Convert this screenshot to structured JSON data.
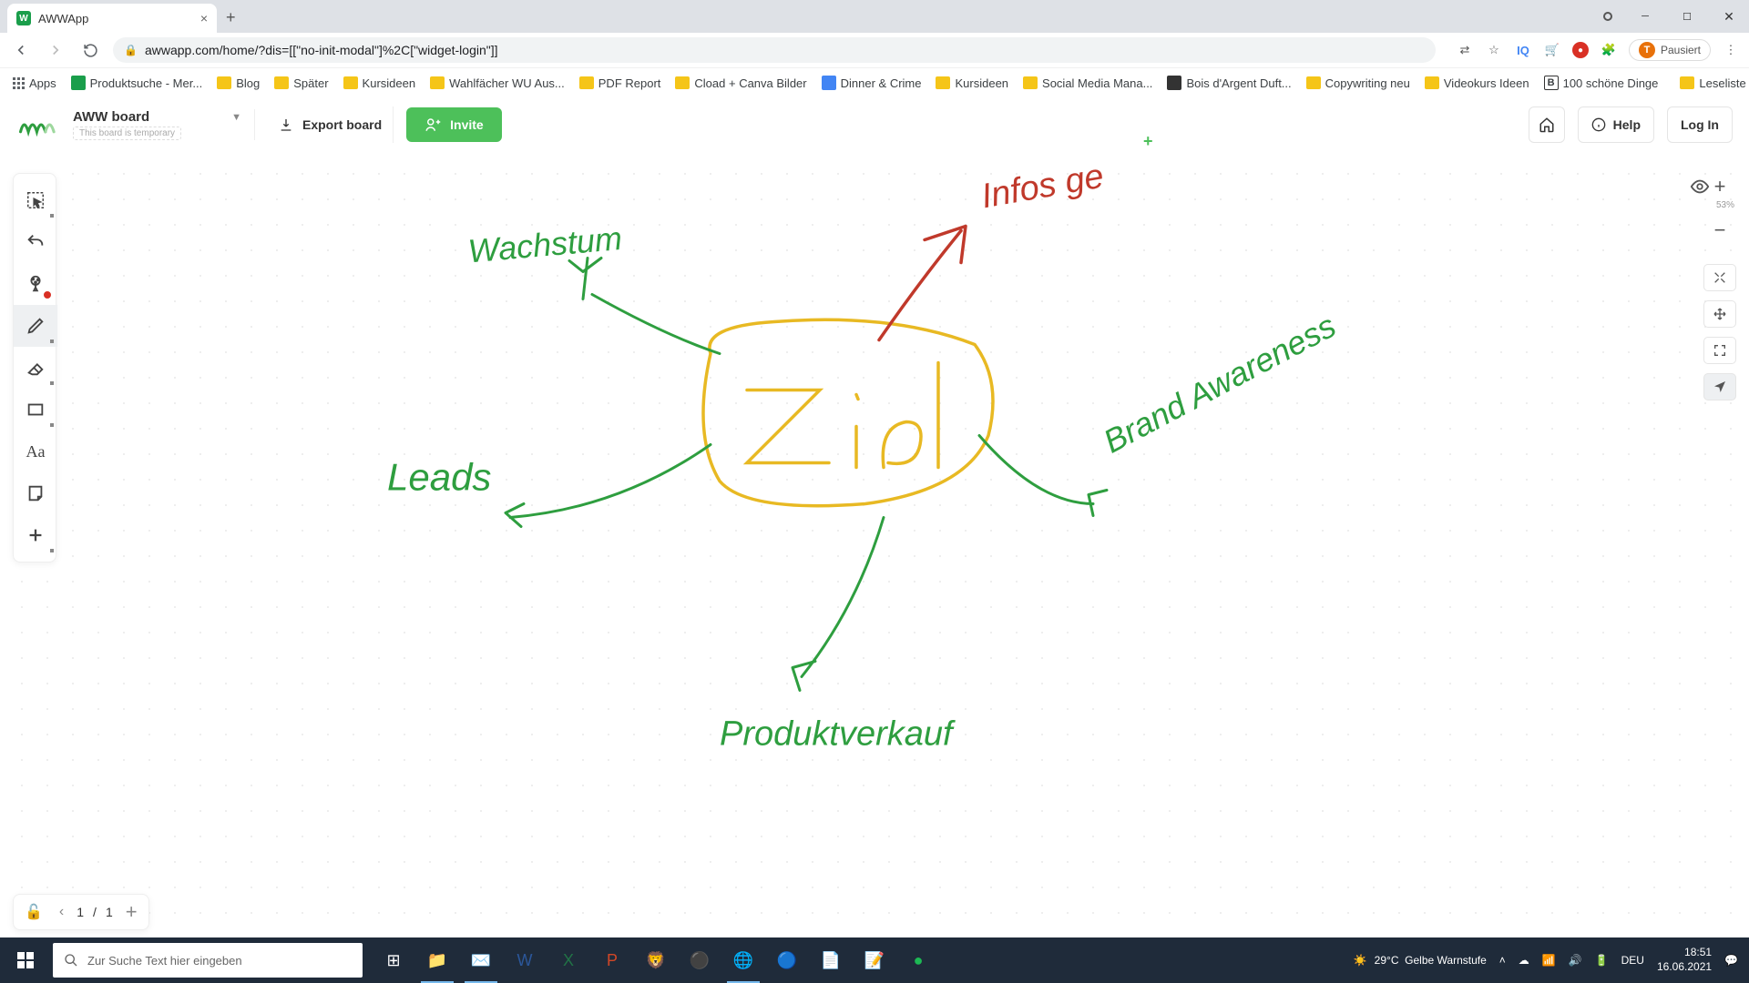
{
  "browser": {
    "tab_title": "AWWApp",
    "url": "awwapp.com/home/?dis=[[\"no-init-modal\"]%2C[\"widget-login\"]]",
    "paused_label": "Pausiert",
    "paused_avatar": "T",
    "apps_label": "Apps",
    "leseliste_label": "Leseliste",
    "bookmarks": [
      "Produktsuche - Mer...",
      "Blog",
      "Später",
      "Kursideen",
      "Wahlfächer WU Aus...",
      "PDF Report",
      "Cload + Canva Bilder",
      "Dinner & Crime",
      "Kursideen",
      "Social Media Mana...",
      "Bois d'Argent Duft...",
      "Copywriting neu",
      "Videokurs Ideen",
      "100 schöne Dinge"
    ]
  },
  "app": {
    "board_name": "AWW board",
    "board_temp": "This board is temporary",
    "export_label": "Export board",
    "invite_label": "Invite",
    "help_label": "Help",
    "login_label": "Log In",
    "zoom_label": "53%",
    "page_current": "1",
    "page_total": "1"
  },
  "canvas": {
    "center": "Ziel",
    "nodes": {
      "growth": "Wachstum",
      "leads": "Leads",
      "product": "Produktverkauf",
      "awareness": "Brand Awareness",
      "infos": "Infos ge"
    },
    "colors": {
      "green": "#2e9e3f",
      "yellow": "#e8b923",
      "red": "#c0392b"
    }
  },
  "taskbar": {
    "search_placeholder": "Zur Suche Text hier eingeben",
    "weather_temp": "29°C",
    "weather_status": "Gelbe Warnstufe",
    "lang": "DEU",
    "time": "18:51",
    "date": "16.06.2021"
  }
}
